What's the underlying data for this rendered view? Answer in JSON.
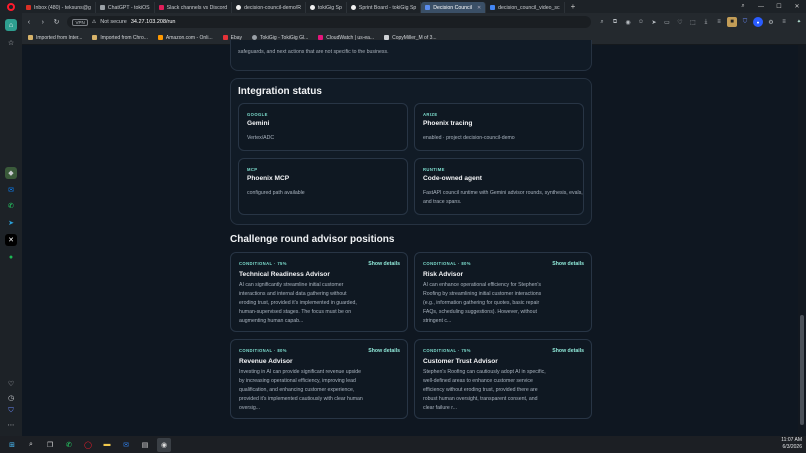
{
  "tabs": [
    {
      "label": "Inbox (480) - teksuns@g",
      "color": "#d93025"
    },
    {
      "label": "ChatGPT - tokiOS",
      "color": "#9aa0a6"
    },
    {
      "label": "Slack channels vs Discord",
      "color": "#e01e5a"
    },
    {
      "label": "decision-council-demo/R",
      "color": "#f0f0f0"
    },
    {
      "label": "tokiGig Sp",
      "color": "#f0f0f0"
    },
    {
      "label": "Sprint Board - tokiGig Sp",
      "color": "#f0f0f0"
    },
    {
      "label": "Decision Council",
      "color": "#5b8def",
      "active": true
    },
    {
      "label": "decision_council_video_sc",
      "color": "#4285f4"
    }
  ],
  "newtab": "+",
  "address": {
    "vpn": "VPN",
    "not_secure": "Not secure",
    "url": "34.27.103.208/run"
  },
  "bookmarks": [
    {
      "label": "Imported from Inter...",
      "color": "#d7b36a"
    },
    {
      "label": "Imported from Chro...",
      "color": "#d7b36a"
    },
    {
      "label": "Amazon.com - Onli...",
      "color": "#ff9900"
    },
    {
      "label": "Ebay",
      "color": "#e53238"
    },
    {
      "label": "TokiGig - TokiGig Gl...",
      "color": "#9aa0a6"
    },
    {
      "label": "CloudWatch | us-ea...",
      "color": "#e7157b"
    },
    {
      "label": "CopyMiller_M of 3...",
      "color": "#cfd2d5"
    }
  ],
  "page": {
    "top_text": "safeguards, and next actions that are not specific to the business.",
    "integration": {
      "heading": "Integration status",
      "cards": [
        {
          "kicker": "GOOGLE",
          "title": "Gemini",
          "desc": "Vertex/ADC"
        },
        {
          "kicker": "ARIZE",
          "title": "Phoenix tracing",
          "desc": "enabled · project decision-council-demo"
        },
        {
          "kicker": "MCP",
          "title": "Phoenix MCP",
          "desc": "configured path available"
        },
        {
          "kicker": "RUNTIME",
          "title": "Code-owned agent",
          "desc": "FastAPI council runtime with Gemini advisor rounds, synthesis, evals, and trace spans."
        }
      ]
    },
    "challenge": {
      "heading": "Challenge round advisor positions",
      "show_label": "Show details",
      "advisors": [
        {
          "kicker": "CONDITIONAL · 75%",
          "title": "Technical Readiness Advisor",
          "desc": "AI can significantly streamline initial customer interactions and internal data gathering without eroding trust, provided it's implemented in guarded, human-supervised stages. The focus must be on augmenting human capab..."
        },
        {
          "kicker": "CONDITIONAL · 80%",
          "title": "Risk Advisor",
          "desc": "AI can enhance operational efficiency for Stephen's Roofing by streamlining initial customer interactions (e.g., information gathering for quotes, basic repair FAQs, scheduling suggestions). However, without stringent c..."
        },
        {
          "kicker": "CONDITIONAL · 80%",
          "title": "Revenue Advisor",
          "desc": "Investing in AI can provide significant revenue upside by increasing operational efficiency, improving lead qualification, and enhancing customer experience, provided it's implemented cautiously with clear human oversig..."
        },
        {
          "kicker": "CONDITIONAL · 75%",
          "title": "Customer Trust Advisor",
          "desc": "Stephen's Roofing can cautiously adopt AI in specific, well-defined areas to enhance customer service efficiency without eroding trust, provided there are robust human oversight, transparent consent, and clear failure r..."
        }
      ]
    }
  },
  "clock": {
    "time": "11:07 AM",
    "date": "6/3/2026"
  }
}
